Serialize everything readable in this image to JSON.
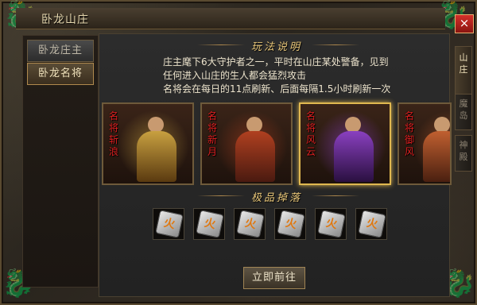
{
  "window": {
    "title": "卧龙山庄",
    "close_label": "×"
  },
  "nav": [
    {
      "label": "卧龙庄主",
      "active": false
    },
    {
      "label": "卧龙名将",
      "active": true
    }
  ],
  "side_tabs": [
    {
      "label": "山庄",
      "active": true
    },
    {
      "label": "魔岛",
      "active": false
    },
    {
      "label": "神殿",
      "active": false
    }
  ],
  "rules": {
    "title": "玩法说明",
    "line1": "庄主麾下6大守护者之一，平时在山庄某处警备，见到",
    "line2": "任何进入山庄的生人都会猛烈攻击",
    "line3": "名将会在每日的11点刷新、后面每隔1.5小时刷新一次"
  },
  "generals": [
    {
      "label": "名将斩浪",
      "selected": false,
      "color": "#c8a040"
    },
    {
      "label": "名将新月",
      "selected": false,
      "color": "#b04020"
    },
    {
      "label": "名将风云",
      "selected": true,
      "color": "#8a40c0"
    },
    {
      "label": "名将御风",
      "selected": false,
      "color": "#c06030"
    }
  ],
  "drops": {
    "title": "极品掉落",
    "items": [
      {
        "glyph": "火",
        "icon": "rune-stone-icon"
      },
      {
        "glyph": "火",
        "icon": "rune-stone-icon"
      },
      {
        "glyph": "火",
        "icon": "rune-stone-icon"
      },
      {
        "glyph": "火",
        "icon": "rune-stone-icon"
      },
      {
        "glyph": "火",
        "icon": "rune-stone-icon"
      },
      {
        "glyph": "火",
        "icon": "rune-stone-icon"
      }
    ]
  },
  "action": {
    "go_label": "立即前往"
  }
}
